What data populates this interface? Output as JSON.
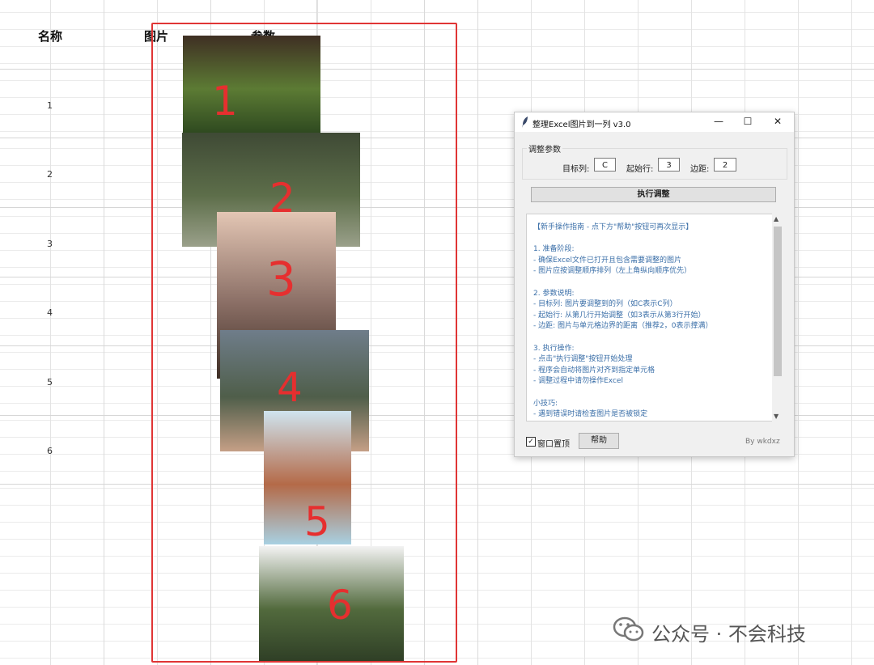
{
  "sheet": {
    "headers": [
      "名称",
      "图片",
      "参数"
    ],
    "row_numbers": [
      "1",
      "2",
      "3",
      "4",
      "5",
      "6"
    ]
  },
  "images": [
    {
      "label": "1",
      "colors": [
        "#3f2f23",
        "#5c7b34",
        "#2f4a20"
      ]
    },
    {
      "label": "2",
      "colors": [
        "#3f4a35",
        "#5d6e4a",
        "#9aa08a"
      ]
    },
    {
      "label": "3",
      "colors": [
        "#e3c6b4",
        "#8a6e65",
        "#3e2e25"
      ]
    },
    {
      "label": "4",
      "colors": [
        "#6f7d8a",
        "#4f5e4a",
        "#c59f86"
      ]
    },
    {
      "label": "5",
      "colors": [
        "#cfe4ef",
        "#b46a48",
        "#a8d0e2"
      ]
    },
    {
      "label": "6",
      "colors": [
        "#f3f3f3",
        "#526a3d",
        "#2f3f26"
      ]
    }
  ],
  "dialog": {
    "title": "整理Excel图片到一列 v3.0",
    "group_label": "调整参数",
    "param_target_label": "目标列:",
    "param_target_value": "C",
    "param_start_label": "起始行:",
    "param_start_value": "3",
    "param_margin_label": "边距:",
    "param_margin_value": "2",
    "run_button": "执行调整",
    "guide_lines": [
      "【新手操作指南 - 点下方\"帮助\"按钮可再次显示】",
      "",
      "1. 准备阶段:",
      "   - 确保Excel文件已打开且包含需要调整的图片",
      "   - 图片应按调整顺序排列（左上角纵向顺序优先）",
      "",
      "2. 参数说明:",
      "   - 目标列: 图片要调整到的列（如C表示C列）",
      "   - 起始行: 从第几行开始调整（如3表示从第3行开始）",
      "   - 边距: 图片与单元格边界的距离（推荐2，0表示撑满）",
      "",
      "3. 执行操作:",
      "   - 点击\"执行调整\"按钮开始处理",
      "   - 程序会自动将图片对齐到指定单元格",
      "   - 调整过程中请勿操作Excel",
      "",
      "小技巧:",
      "- 遇到错误时请检查图片是否被锁定"
    ],
    "topmost_label": "窗口置顶",
    "topmost_checked": "✓",
    "help_button": "帮助",
    "byline": "By wkdxz",
    "min_glyph": "—",
    "max_glyph": "☐",
    "close_glyph": "✕"
  },
  "watermark": {
    "text": "公众号 · 不会科技"
  }
}
